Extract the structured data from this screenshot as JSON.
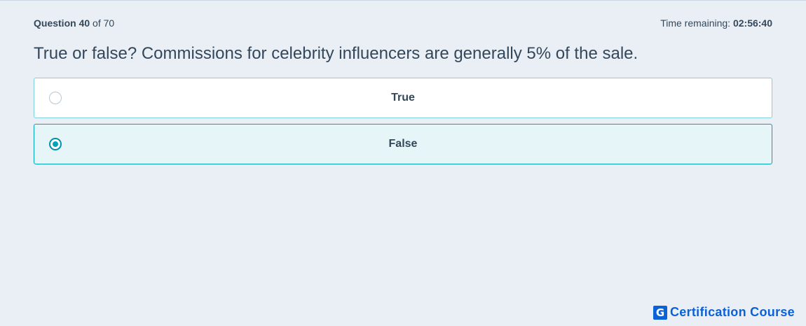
{
  "header": {
    "question_word": "Question",
    "current": "40",
    "of_total": "of 70",
    "time_label": "Time remaining:",
    "time_value": "02:56:40"
  },
  "question": {
    "text": "True or false? Commissions for celebrity influencers are generally 5% of the sale."
  },
  "options": [
    {
      "label": "True",
      "selected": false
    },
    {
      "label": "False",
      "selected": true
    }
  ],
  "brand": {
    "icon_letter": "G",
    "name": "Certification Course",
    "color": "#0b61d6"
  },
  "colors": {
    "accent": "#00a4bd",
    "text": "#33475b",
    "background": "#eaeff5"
  }
}
